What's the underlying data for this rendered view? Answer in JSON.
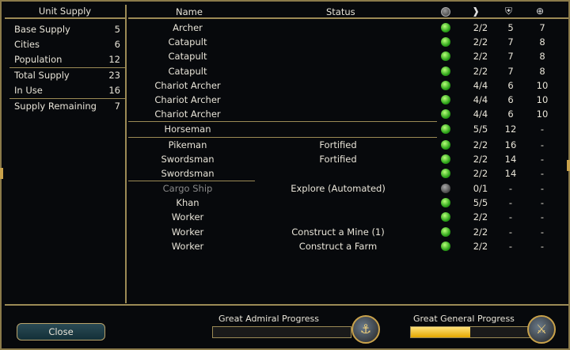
{
  "left_panel": {
    "title": "Unit Supply",
    "rows": [
      {
        "label": "Base Supply",
        "value": "5"
      },
      {
        "label": "Cities",
        "value": "6"
      },
      {
        "label": "Population",
        "value": "12"
      },
      {
        "label": "Total Supply",
        "value": "23"
      },
      {
        "label": "In Use",
        "value": "16"
      },
      {
        "label": "Supply Remaining",
        "value": "7"
      }
    ]
  },
  "table": {
    "headers": {
      "name": "Name",
      "status": "Status",
      "health_icon": "health-dot-icon",
      "moves_icon": "movement-icon",
      "strength_icon": "strength-shield-icon",
      "range_icon": "ranged-target-icon"
    },
    "units": [
      {
        "name": "Archer",
        "status": "",
        "ready": true,
        "moves": "2/2",
        "strength": "5",
        "ranged": "7"
      },
      {
        "name": "Catapult",
        "status": "",
        "ready": true,
        "moves": "2/2",
        "strength": "7",
        "ranged": "8"
      },
      {
        "name": "Catapult",
        "status": "",
        "ready": true,
        "moves": "2/2",
        "strength": "7",
        "ranged": "8"
      },
      {
        "name": "Catapult",
        "status": "",
        "ready": true,
        "moves": "2/2",
        "strength": "7",
        "ranged": "8"
      },
      {
        "name": "Chariot Archer",
        "status": "",
        "ready": true,
        "moves": "4/4",
        "strength": "6",
        "ranged": "10"
      },
      {
        "name": "Chariot Archer",
        "status": "",
        "ready": true,
        "moves": "4/4",
        "strength": "6",
        "ranged": "10"
      },
      {
        "name": "Chariot Archer",
        "status": "",
        "ready": true,
        "moves": "4/4",
        "strength": "6",
        "ranged": "10"
      },
      {
        "name": "Horseman",
        "status": "",
        "ready": true,
        "moves": "5/5",
        "strength": "12",
        "ranged": "-"
      },
      {
        "name": "Pikeman",
        "status": "Fortified",
        "ready": true,
        "moves": "2/2",
        "strength": "16",
        "ranged": "-"
      },
      {
        "name": "Swordsman",
        "status": "Fortified",
        "ready": true,
        "moves": "2/2",
        "strength": "14",
        "ranged": "-"
      },
      {
        "name": "Swordsman",
        "status": "",
        "ready": true,
        "moves": "2/2",
        "strength": "14",
        "ranged": "-"
      },
      {
        "name": "Cargo Ship",
        "status": "Explore (Automated)",
        "ready": false,
        "moves": "0/1",
        "strength": "-",
        "ranged": "-"
      },
      {
        "name": "Khan",
        "status": "",
        "ready": true,
        "moves": "5/5",
        "strength": "-",
        "ranged": "-"
      },
      {
        "name": "Worker",
        "status": "",
        "ready": true,
        "moves": "2/2",
        "strength": "-",
        "ranged": "-"
      },
      {
        "name": "Worker",
        "status": "Construct a Mine (1)",
        "ready": true,
        "moves": "2/2",
        "strength": "-",
        "ranged": "-"
      },
      {
        "name": "Worker",
        "status": "Construct a Farm",
        "ready": true,
        "moves": "2/2",
        "strength": "-",
        "ranged": "-"
      }
    ]
  },
  "bottom": {
    "close_label": "Close",
    "admiral_label": "Great Admiral Progress",
    "admiral_progress": 0,
    "admiral_icon": "admiral-ship-icon",
    "general_label": "Great General Progress",
    "general_progress": 0.5,
    "general_icon": "general-warrior-icon"
  },
  "colors": {
    "frame_gold": "#9b8a55",
    "ready_green": "#2ea51a",
    "progress_yellow": "#e5a800",
    "button_teal": "#133038"
  }
}
